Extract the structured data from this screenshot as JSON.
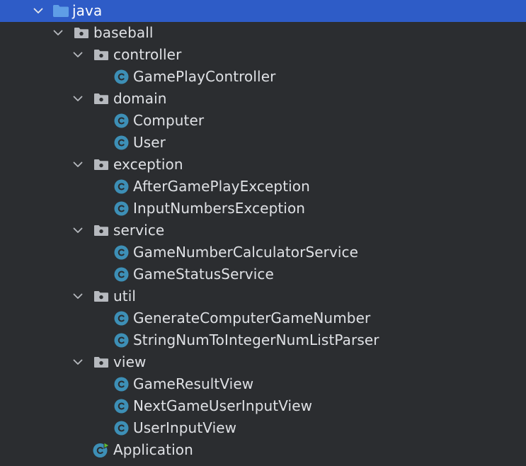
{
  "tree": {
    "root": "java",
    "package": "baseball",
    "groups": [
      {
        "name": "controller",
        "classes": [
          "GamePlayController"
        ]
      },
      {
        "name": "domain",
        "classes": [
          "Computer",
          "User"
        ]
      },
      {
        "name": "exception",
        "classes": [
          "AfterGamePlayException",
          "InputNumbersException"
        ]
      },
      {
        "name": "service",
        "classes": [
          "GameNumberCalculatorService",
          "GameStatusService"
        ]
      },
      {
        "name": "util",
        "classes": [
          "GenerateComputerGameNumber",
          "StringNumToIntegerNumListParser"
        ]
      },
      {
        "name": "view",
        "classes": [
          "GameResultView",
          "NextGameUserInputView",
          "UserInputView"
        ]
      }
    ],
    "main_class": "Application"
  },
  "colors": {
    "background": "#2b2d30",
    "selection": "#2e5cc7",
    "text": "#dfe1e5",
    "class_icon": "#3d8fb6",
    "folder_icon": "#b6b9be",
    "root_folder_icon": "#5f9ee6",
    "run_badge": "#5fb832"
  },
  "icons": {
    "expanded": "chevron-down-icon",
    "source_root": "source-folder-icon",
    "package": "package-folder-icon",
    "class": "java-class-icon",
    "main_class": "runnable-class-icon"
  }
}
